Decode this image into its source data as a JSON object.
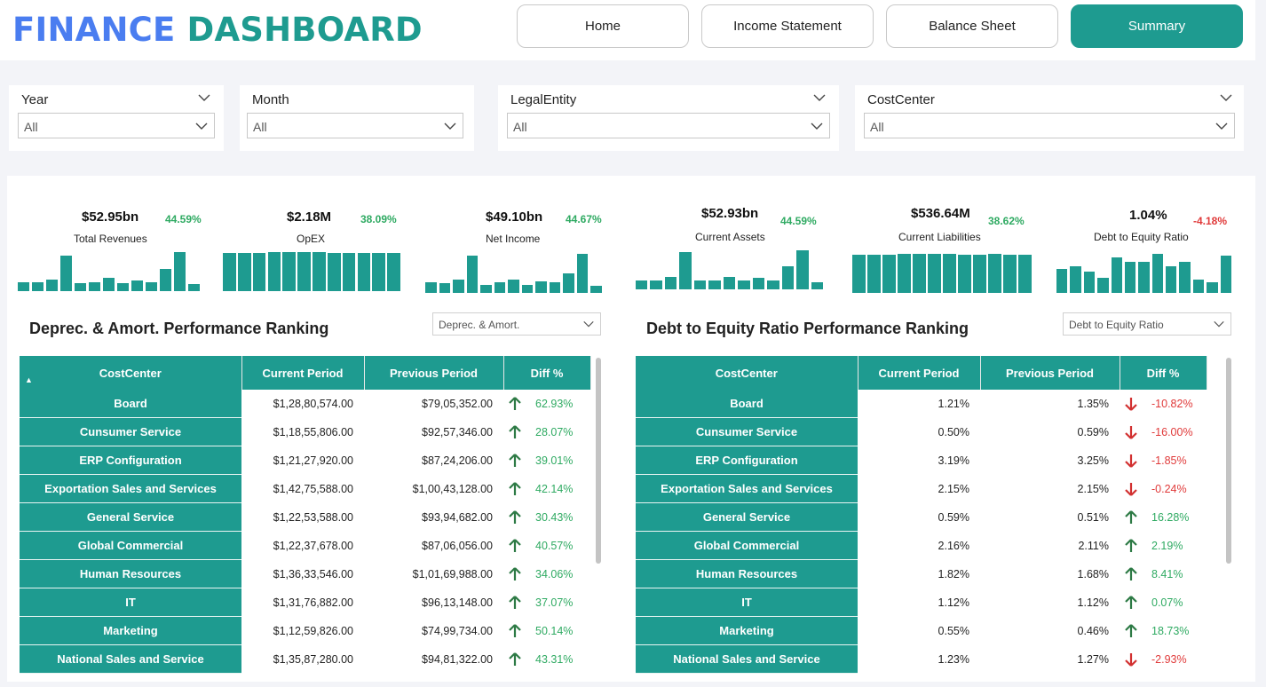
{
  "header": {
    "title_part1": "FINANCE",
    "title_part2": "DASHBOARD",
    "nav": [
      {
        "label": "Home",
        "active": false
      },
      {
        "label": "Income Statement",
        "active": false
      },
      {
        "label": "Balance Sheet",
        "active": false
      },
      {
        "label": "Summary",
        "active": true
      }
    ]
  },
  "filters": [
    {
      "label": "Year",
      "value": "All"
    },
    {
      "label": "Month",
      "value": "All"
    },
    {
      "label": "LegalEntity",
      "value": "All"
    },
    {
      "label": "CostCenter",
      "value": "All"
    }
  ],
  "colors": {
    "accent": "#1e9b90",
    "title_blue": "#4a7df0",
    "positive": "#2faa62",
    "negative": "#e03a3a"
  },
  "kpis": [
    {
      "value": "$52.95bn",
      "pct": "44.59%",
      "label": "Total Revenues",
      "trend": "positive",
      "bars": [
        0.25,
        0.25,
        0.33,
        1.0,
        0.23,
        0.25,
        0.38,
        0.23,
        0.3,
        0.25,
        0.63,
        1.1,
        0.2
      ]
    },
    {
      "value": "$2.18M",
      "pct": "38.09%",
      "label": "OpEX",
      "trend": "positive",
      "bars": [
        0.97,
        0.97,
        0.97,
        1.0,
        1.0,
        1.0,
        1.0,
        0.97,
        0.97,
        0.97,
        0.97,
        0.97
      ]
    },
    {
      "value": "$49.10bn",
      "pct": "44.67%",
      "label": "Net Income",
      "trend": "positive",
      "bars": [
        0.28,
        0.25,
        0.33,
        0.95,
        0.2,
        0.28,
        0.33,
        0.2,
        0.3,
        0.28,
        0.5,
        1.0,
        0.18
      ]
    },
    {
      "value": "$52.93bn",
      "pct": "44.59%",
      "label": "Current Assets",
      "trend": "positive",
      "bars": [
        0.25,
        0.25,
        0.33,
        1.0,
        0.23,
        0.25,
        0.33,
        0.23,
        0.3,
        0.25,
        0.63,
        1.05,
        0.2
      ]
    },
    {
      "value": "$536.64M",
      "pct": "38.62%",
      "label": "Current Liabilities",
      "trend": "positive",
      "bars": [
        0.97,
        0.97,
        0.97,
        1.0,
        1.0,
        1.0,
        1.0,
        0.97,
        0.97,
        1.0,
        0.97,
        0.97
      ]
    },
    {
      "value": "1.04%",
      "pct": "-4.18%",
      "label": "Debt to Equity Ratio",
      "trend": "negative",
      "bars": [
        0.55,
        0.62,
        0.5,
        0.35,
        0.82,
        0.72,
        0.72,
        0.9,
        0.62,
        0.72,
        0.3,
        0.25,
        0.85
      ]
    }
  ],
  "rank_left": {
    "title": "Deprec. & Amort. Performance Ranking",
    "dropdown": "Deprec. & Amort.",
    "columns": [
      "CostCenter",
      "Current Period",
      "Previous Period",
      "Diff %"
    ],
    "sort_indicator": "▲",
    "rows": [
      {
        "name": "Board",
        "current": "$1,28,80,574.00",
        "previous": "$79,05,352.00",
        "diff": "62.93%",
        "dir": "up"
      },
      {
        "name": "Cunsumer Service",
        "current": "$1,18,55,806.00",
        "previous": "$92,57,346.00",
        "diff": "28.07%",
        "dir": "up"
      },
      {
        "name": "ERP Configuration",
        "current": "$1,21,27,920.00",
        "previous": "$87,24,206.00",
        "diff": "39.01%",
        "dir": "up"
      },
      {
        "name": "Exportation Sales and Services",
        "current": "$1,42,75,588.00",
        "previous": "$1,00,43,128.00",
        "diff": "42.14%",
        "dir": "up"
      },
      {
        "name": "General Service",
        "current": "$1,22,53,588.00",
        "previous": "$93,94,682.00",
        "diff": "30.43%",
        "dir": "up"
      },
      {
        "name": "Global Commercial",
        "current": "$1,22,37,678.00",
        "previous": "$87,06,056.00",
        "diff": "40.57%",
        "dir": "up"
      },
      {
        "name": "Human Resources",
        "current": "$1,36,33,546.00",
        "previous": "$1,01,69,988.00",
        "diff": "34.06%",
        "dir": "up"
      },
      {
        "name": "IT",
        "current": "$1,31,76,882.00",
        "previous": "$96,13,148.00",
        "diff": "37.07%",
        "dir": "up"
      },
      {
        "name": "Marketing",
        "current": "$1,12,59,826.00",
        "previous": "$74,99,734.00",
        "diff": "50.14%",
        "dir": "up"
      },
      {
        "name": "National Sales and Service",
        "current": "$1,35,87,280.00",
        "previous": "$94,81,322.00",
        "diff": "43.31%",
        "dir": "up"
      }
    ]
  },
  "rank_right": {
    "title": "Debt to Equity Ratio Performance Ranking",
    "dropdown": "Debt to Equity Ratio",
    "columns": [
      "CostCenter",
      "Current Period",
      "Previous Period",
      "Diff %"
    ],
    "rows": [
      {
        "name": "Board",
        "current": "1.21%",
        "previous": "1.35%",
        "diff": "-10.82%",
        "dir": "down"
      },
      {
        "name": "Cunsumer Service",
        "current": "0.50%",
        "previous": "0.59%",
        "diff": "-16.00%",
        "dir": "down"
      },
      {
        "name": "ERP Configuration",
        "current": "3.19%",
        "previous": "3.25%",
        "diff": "-1.85%",
        "dir": "down"
      },
      {
        "name": "Exportation Sales and Services",
        "current": "2.15%",
        "previous": "2.15%",
        "diff": "-0.24%",
        "dir": "down"
      },
      {
        "name": "General Service",
        "current": "0.59%",
        "previous": "0.51%",
        "diff": "16.28%",
        "dir": "up"
      },
      {
        "name": "Global Commercial",
        "current": "2.16%",
        "previous": "2.11%",
        "diff": "2.19%",
        "dir": "up"
      },
      {
        "name": "Human Resources",
        "current": "1.82%",
        "previous": "1.68%",
        "diff": "8.41%",
        "dir": "up"
      },
      {
        "name": "IT",
        "current": "1.12%",
        "previous": "1.12%",
        "diff": "0.07%",
        "dir": "up"
      },
      {
        "name": "Marketing",
        "current": "0.55%",
        "previous": "0.46%",
        "diff": "18.73%",
        "dir": "up"
      },
      {
        "name": "National Sales and Service",
        "current": "1.23%",
        "previous": "1.27%",
        "diff": "-2.93%",
        "dir": "down"
      }
    ]
  }
}
